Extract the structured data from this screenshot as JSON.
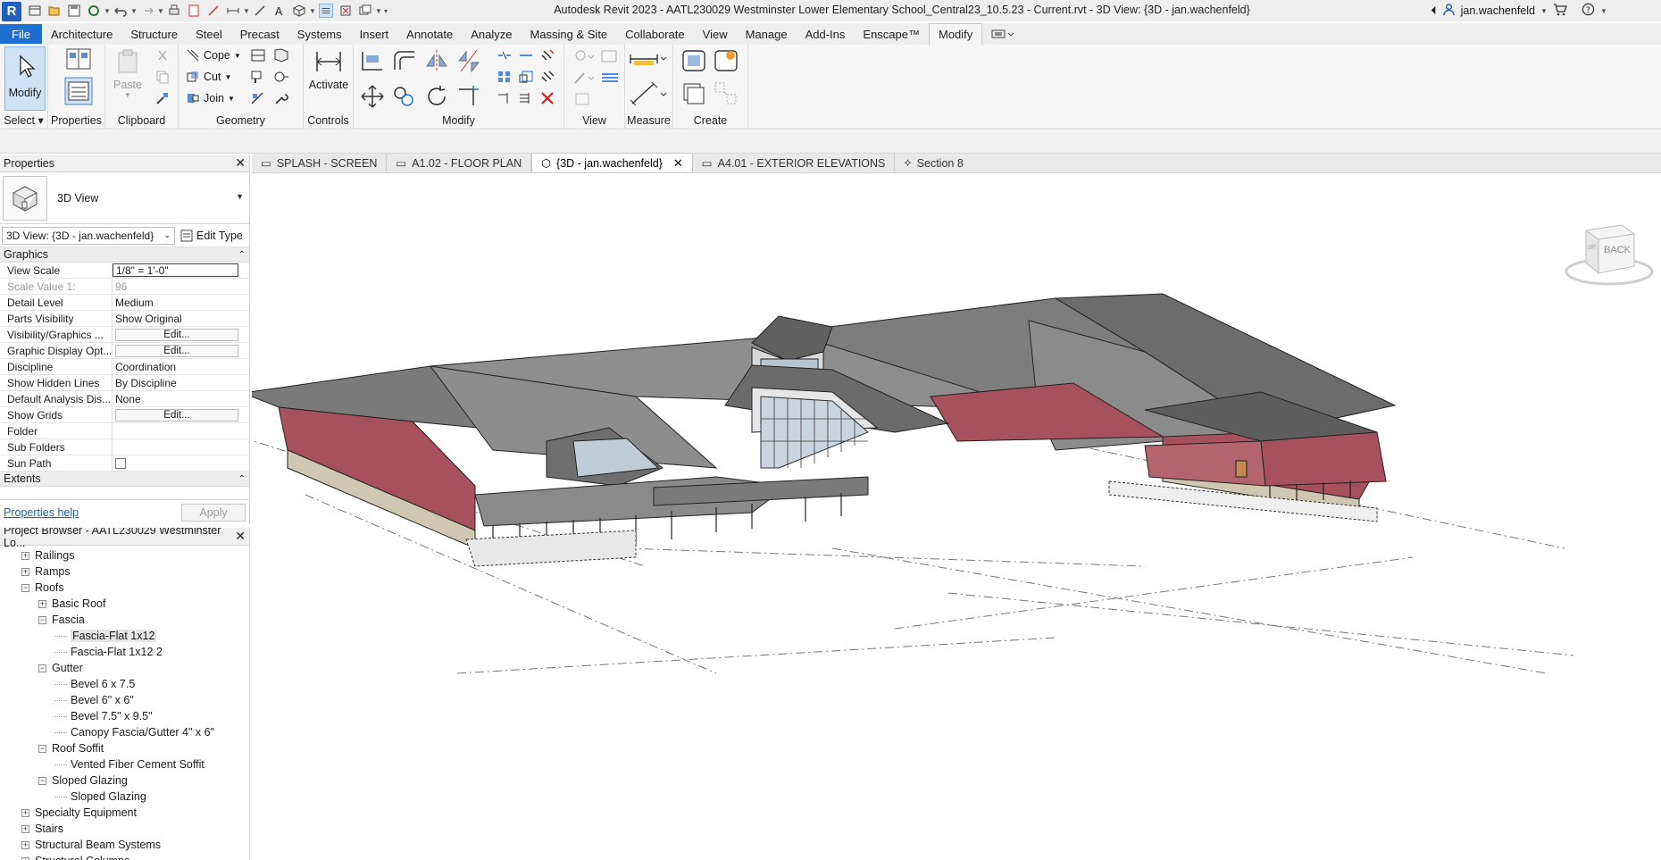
{
  "app": {
    "logo_letter": "R",
    "title": "Autodesk Revit 2023 - AATL230029 Westminster Lower Elementary School_Central23_10.5.23 - Current.rvt - 3D View: {3D - jan.wachenfeld}",
    "user": "jan.wachenfeld"
  },
  "menu": [
    "File",
    "Architecture",
    "Structure",
    "Steel",
    "Precast",
    "Systems",
    "Insert",
    "Annotate",
    "Analyze",
    "Massing & Site",
    "Collaborate",
    "View",
    "Manage",
    "Add-Ins",
    "Enscape™",
    "Modify"
  ],
  "menu_active": "Modify",
  "ribbon": {
    "modify_label": "Modify",
    "select_label": "Select",
    "properties_label": "Properties",
    "paste_label": "Paste",
    "clipboard_label": "Clipboard",
    "cope_label": "Cope",
    "cut_label": "Cut",
    "join_label": "Join",
    "geometry_label": "Geometry",
    "activate_label": "Activate",
    "controls_label": "Controls",
    "modify_panel_label": "Modify",
    "view_label": "View",
    "measure_label": "Measure",
    "create_label": "Create"
  },
  "properties": {
    "header": "Properties",
    "type_name": "3D View",
    "instance": "3D View: {3D - jan.wachenfeld}",
    "edit_type": "Edit Type",
    "group_graphics": "Graphics",
    "rows": [
      {
        "key": "View Scale",
        "value": "1/8\" = 1'-0\""
      },
      {
        "key": "Scale Value    1:",
        "value": "96"
      },
      {
        "key": "Detail Level",
        "value": "Medium"
      },
      {
        "key": "Parts Visibility",
        "value": "Show Original"
      },
      {
        "key": "Visibility/Graphics ...",
        "value": "Edit..."
      },
      {
        "key": "Graphic Display Opt...",
        "value": "Edit..."
      },
      {
        "key": "Discipline",
        "value": "Coordination"
      },
      {
        "key": "Show Hidden Lines",
        "value": "By Discipline"
      },
      {
        "key": "Default Analysis Dis...",
        "value": "None"
      },
      {
        "key": "Show Grids",
        "value": "Edit..."
      },
      {
        "key": "Folder",
        "value": ""
      },
      {
        "key": "Sub Folders",
        "value": ""
      },
      {
        "key": "Sun Path",
        "value": ""
      }
    ],
    "group_extents": "Extents",
    "help_link": "Properties help",
    "apply": "Apply"
  },
  "browser": {
    "header": "Project Browser - AATL230029 Westminster Lo...",
    "items": [
      {
        "label": "Railings",
        "level": 1,
        "toggle": "+"
      },
      {
        "label": "Ramps",
        "level": 1,
        "toggle": "+"
      },
      {
        "label": "Roofs",
        "level": 1,
        "toggle": "-"
      },
      {
        "label": "Basic Roof",
        "level": 2,
        "toggle": "+"
      },
      {
        "label": "Fascia",
        "level": 2,
        "toggle": "-"
      },
      {
        "label": "Fascia-Flat 1x12",
        "level": 3,
        "toggle": "",
        "selected": true
      },
      {
        "label": "Fascia-Flat 1x12 2",
        "level": 3,
        "toggle": ""
      },
      {
        "label": "Gutter",
        "level": 2,
        "toggle": "-"
      },
      {
        "label": "Bevel 6 x 7.5",
        "level": 3,
        "toggle": ""
      },
      {
        "label": "Bevel 6\" x 6\"",
        "level": 3,
        "toggle": ""
      },
      {
        "label": "Bevel 7.5\" x 9.5\"",
        "level": 3,
        "toggle": ""
      },
      {
        "label": "Canopy Fascia/Gutter 4\" x 6\"",
        "level": 3,
        "toggle": ""
      },
      {
        "label": "Roof Soffit",
        "level": 2,
        "toggle": "-"
      },
      {
        "label": "Vented Fiber Cement Soffit",
        "level": 3,
        "toggle": ""
      },
      {
        "label": "Sloped Glazing",
        "level": 2,
        "toggle": "-"
      },
      {
        "label": "Sloped Glazing",
        "level": 3,
        "toggle": ""
      },
      {
        "label": "Specialty Equipment",
        "level": 1,
        "toggle": "+"
      },
      {
        "label": "Stairs",
        "level": 1,
        "toggle": "+"
      },
      {
        "label": "Structural Beam Systems",
        "level": 1,
        "toggle": "+"
      },
      {
        "label": "Structural Columns",
        "level": 1,
        "toggle": "+"
      }
    ]
  },
  "view_tabs": [
    {
      "label": "SPLASH - SCREEN",
      "active": false
    },
    {
      "label": "A1.02 - FLOOR PLAN",
      "active": false
    },
    {
      "label": "{3D - jan.wachenfeld}",
      "active": true
    },
    {
      "label": "A4.01 - EXTERIOR ELEVATIONS",
      "active": false
    },
    {
      "label": "Section 8",
      "active": false
    }
  ],
  "viewcube": {
    "face_label": "BACK",
    "side_label": "LEFT"
  },
  "colors": {
    "accent": "#1f6fd0",
    "roof": "#6f6f6f",
    "wall_red": "#a7505e",
    "stone": "#cfc7b2"
  }
}
